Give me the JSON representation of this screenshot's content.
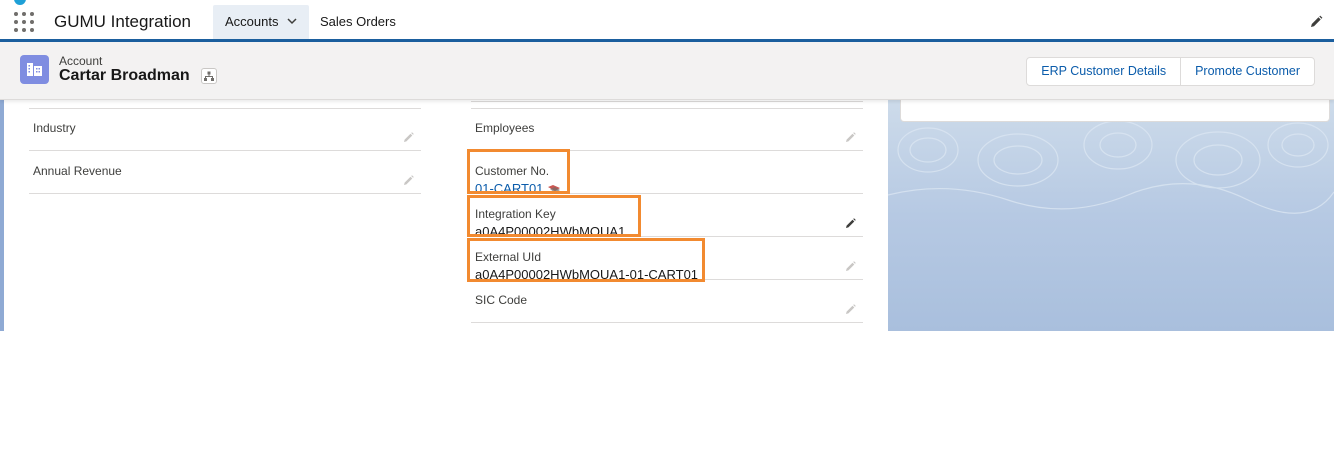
{
  "app": {
    "name": "GUMU Integration"
  },
  "nav": {
    "tabs": [
      {
        "label": "Accounts",
        "active": true
      },
      {
        "label": "Sales Orders",
        "active": false
      }
    ]
  },
  "header": {
    "object_label": "Account",
    "record_name": "Cartar Broadman",
    "buttons": [
      "ERP Customer Details",
      "Promote Customer"
    ]
  },
  "fields": {
    "industry": {
      "label": "Industry",
      "value": ""
    },
    "annual_revenue": {
      "label": "Annual Revenue",
      "value": ""
    },
    "employees": {
      "label": "Employees",
      "value": ""
    },
    "customer_no": {
      "label": "Customer No.",
      "value": "01-CART01"
    },
    "integration_key": {
      "label": "Integration Key",
      "value": "a0A4P00002HWbMOUA1"
    },
    "external_uid": {
      "label": "External UId",
      "value": "a0A4P00002HWbMOUA1-01-CART01"
    },
    "sic_code": {
      "label": "SIC Code",
      "value": ""
    }
  },
  "colors": {
    "brand_bar": "#1b5f9e",
    "highlight": "#f28a30",
    "link": "#0b5cab",
    "account_icon": "#7f8de1"
  },
  "icons": [
    "app-launcher-icon",
    "chevron-down-icon",
    "pencil-icon",
    "account-icon",
    "hierarchy-icon",
    "flag-icon"
  ]
}
